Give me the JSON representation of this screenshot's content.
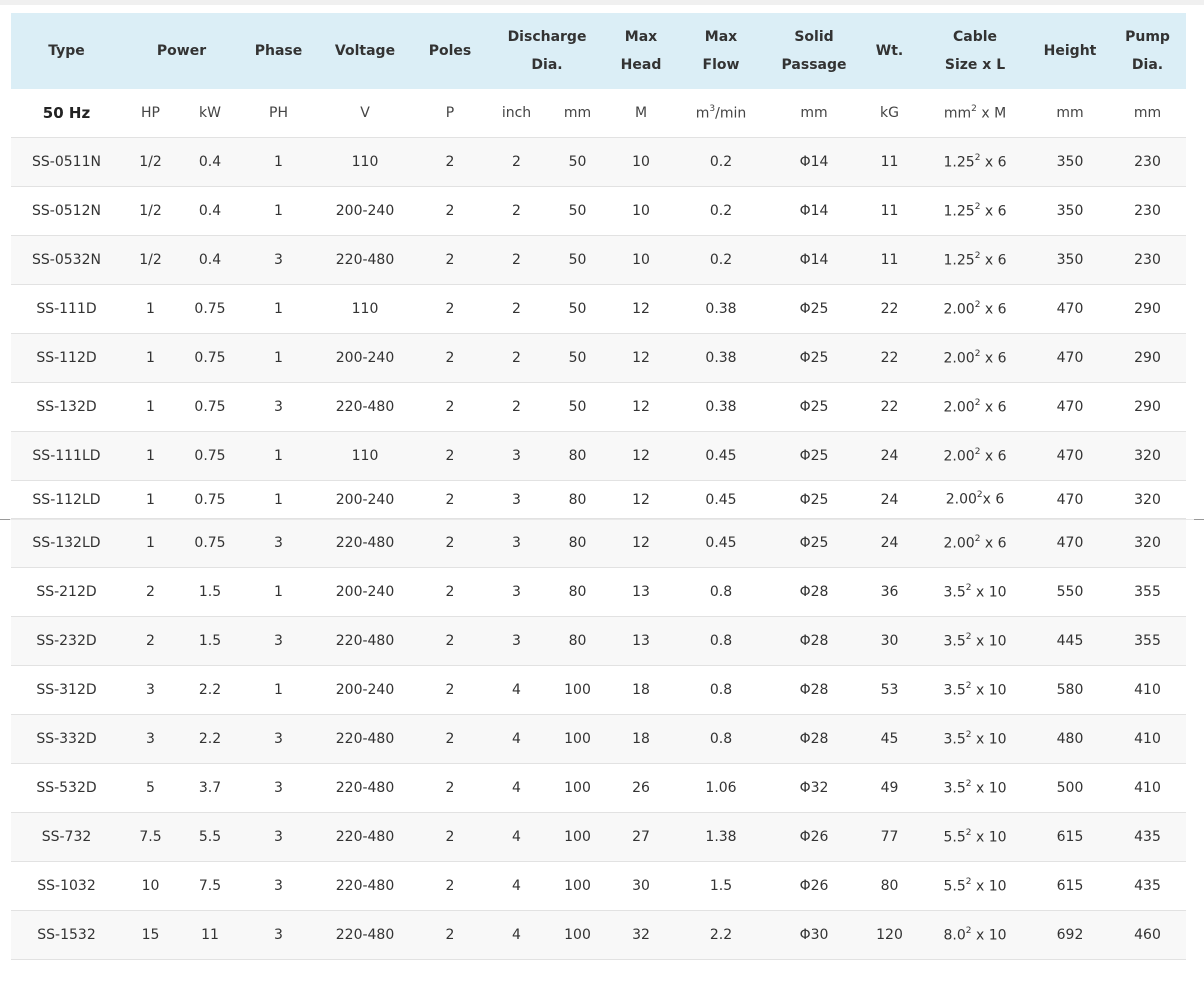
{
  "headers": {
    "type": "Type",
    "power": "Power",
    "phase": "Phase",
    "voltage": "Voltage",
    "poles": "Poles",
    "discharge_1": "Discharge",
    "discharge_2": "Dia.",
    "max_head_1": "Max",
    "max_head_2": "Head",
    "max_flow_1": "Max",
    "max_flow_2": "Flow",
    "solid_1": "Solid",
    "solid_2": "Passage",
    "wt": "Wt.",
    "cable_1": "Cable",
    "cable_2": "Size x L",
    "height": "Height",
    "pump_1": "Pump",
    "pump_2": "Dia."
  },
  "units": {
    "hz": "50 Hz",
    "hp": "HP",
    "kw": "kW",
    "ph": "PH",
    "v": "V",
    "p": "P",
    "inch": "inch",
    "mm_dis": "mm",
    "m": "M",
    "flow_pre": "m",
    "flow_sup": "3",
    "flow_post": "/min",
    "mm_solid": "mm",
    "kg": "kG",
    "cable_pre": "mm",
    "cable_sup": "2",
    "cable_post": " x M",
    "mm_h": "mm",
    "mm_p": "mm"
  },
  "rows": [
    {
      "type": "SS-0511N",
      "hp": "1/2",
      "kw": "0.4",
      "ph": "1",
      "v": "110",
      "p": "2",
      "inch": "2",
      "mm": "50",
      "head": "10",
      "flow": "0.2",
      "solid": "Φ14",
      "wt": "11",
      "cable_base": "1.25",
      "cable_exp": "2",
      "cable_len": " x 6",
      "height": "350",
      "pump": "230"
    },
    {
      "type": "SS-0512N",
      "hp": "1/2",
      "kw": "0.4",
      "ph": "1",
      "v": "200-240",
      "p": "2",
      "inch": "2",
      "mm": "50",
      "head": "10",
      "flow": "0.2",
      "solid": "Φ14",
      "wt": "11",
      "cable_base": "1.25",
      "cable_exp": "2",
      "cable_len": " x 6",
      "height": "350",
      "pump": "230"
    },
    {
      "type": "SS-0532N",
      "hp": "1/2",
      "kw": "0.4",
      "ph": "3",
      "v": "220-480",
      "p": "2",
      "inch": "2",
      "mm": "50",
      "head": "10",
      "flow": "0.2",
      "solid": "Φ14",
      "wt": "11",
      "cable_base": "1.25",
      "cable_exp": "2",
      "cable_len": " x 6",
      "height": "350",
      "pump": "230"
    },
    {
      "type": "SS-111D",
      "hp": "1",
      "kw": "0.75",
      "ph": "1",
      "v": "110",
      "p": "2",
      "inch": "2",
      "mm": "50",
      "head": "12",
      "flow": "0.38",
      "solid": "Φ25",
      "wt": "22",
      "cable_base": "2.00",
      "cable_exp": "2",
      "cable_len": " x 6",
      "height": "470",
      "pump": "290"
    },
    {
      "type": "SS-112D",
      "hp": "1",
      "kw": "0.75",
      "ph": "1",
      "v": "200-240",
      "p": "2",
      "inch": "2",
      "mm": "50",
      "head": "12",
      "flow": "0.38",
      "solid": "Φ25",
      "wt": "22",
      "cable_base": "2.00",
      "cable_exp": "2",
      "cable_len": " x 6",
      "height": "470",
      "pump": "290"
    },
    {
      "type": "SS-132D",
      "hp": "1",
      "kw": "0.75",
      "ph": "3",
      "v": "220-480",
      "p": "2",
      "inch": "2",
      "mm": "50",
      "head": "12",
      "flow": "0.38",
      "solid": "Φ25",
      "wt": "22",
      "cable_base": "2.00",
      "cable_exp": "2",
      "cable_len": " x 6",
      "height": "470",
      "pump": "290"
    },
    {
      "type": "SS-111LD",
      "hp": "1",
      "kw": "0.75",
      "ph": "1",
      "v": "110",
      "p": "2",
      "inch": "3",
      "mm": "80",
      "head": "12",
      "flow": "0.45",
      "solid": "Φ25",
      "wt": "24",
      "cable_base": "2.00",
      "cable_exp": "2",
      "cable_len": " x 6",
      "height": "470",
      "pump": "320"
    },
    {
      "type": "SS-112LD",
      "hp": "1",
      "kw": "0.75",
      "ph": "1",
      "v": "200-240",
      "p": "2",
      "inch": "3",
      "mm": "80",
      "head": "12",
      "flow": "0.45",
      "solid": "Φ25",
      "wt": "24",
      "cable_base": "2.00",
      "cable_exp": "2",
      "cable_len": "x 6",
      "height": "470",
      "pump": "320"
    },
    {
      "type": "SS-132LD",
      "hp": "1",
      "kw": "0.75",
      "ph": "3",
      "v": "220-480",
      "p": "2",
      "inch": "3",
      "mm": "80",
      "head": "12",
      "flow": "0.45",
      "solid": "Φ25",
      "wt": "24",
      "cable_base": "2.00",
      "cable_exp": "2",
      "cable_len": " x 6",
      "height": "470",
      "pump": "320"
    },
    {
      "type": "SS-212D",
      "hp": "2",
      "kw": "1.5",
      "ph": "1",
      "v": "200-240",
      "p": "2",
      "inch": "3",
      "mm": "80",
      "head": "13",
      "flow": "0.8",
      "solid": "Φ28",
      "wt": "36",
      "cable_base": "3.5",
      "cable_exp": "2",
      "cable_len": " x 10",
      "height": "550",
      "pump": "355"
    },
    {
      "type": "SS-232D",
      "hp": "2",
      "kw": "1.5",
      "ph": "3",
      "v": "220-480",
      "p": "2",
      "inch": "3",
      "mm": "80",
      "head": "13",
      "flow": "0.8",
      "solid": "Φ28",
      "wt": "30",
      "cable_base": "3.5",
      "cable_exp": "2",
      "cable_len": " x 10",
      "height": "445",
      "pump": "355"
    },
    {
      "type": "SS-312D",
      "hp": "3",
      "kw": "2.2",
      "ph": "1",
      "v": "200-240",
      "p": "2",
      "inch": "4",
      "mm": "100",
      "head": "18",
      "flow": "0.8",
      "solid": "Φ28",
      "wt": "53",
      "cable_base": "3.5",
      "cable_exp": "2",
      "cable_len": " x 10",
      "height": "580",
      "pump": "410"
    },
    {
      "type": "SS-332D",
      "hp": "3",
      "kw": "2.2",
      "ph": "3",
      "v": "220-480",
      "p": "2",
      "inch": "4",
      "mm": "100",
      "head": "18",
      "flow": "0.8",
      "solid": "Φ28",
      "wt": "45",
      "cable_base": "3.5",
      "cable_exp": "2",
      "cable_len": " x 10",
      "height": "480",
      "pump": "410"
    },
    {
      "type": "SS-532D",
      "hp": "5",
      "kw": "3.7",
      "ph": "3",
      "v": "220-480",
      "p": "2",
      "inch": "4",
      "mm": "100",
      "head": "26",
      "flow": "1.06",
      "solid": "Φ32",
      "wt": "49",
      "cable_base": "3.5",
      "cable_exp": "2",
      "cable_len": " x 10",
      "height": "500",
      "pump": "410"
    },
    {
      "type": "SS-732",
      "hp": "7.5",
      "kw": "5.5",
      "ph": "3",
      "v": "220-480",
      "p": "2",
      "inch": "4",
      "mm": "100",
      "head": "27",
      "flow": "1.38",
      "solid": "Φ26",
      "wt": "77",
      "cable_base": "5.5",
      "cable_exp": "2",
      "cable_len": " x 10",
      "height": "615",
      "pump": "435"
    },
    {
      "type": "SS-1032",
      "hp": "10",
      "kw": "7.5",
      "ph": "3",
      "v": "220-480",
      "p": "2",
      "inch": "4",
      "mm": "100",
      "head": "30",
      "flow": "1.5",
      "solid": "Φ26",
      "wt": "80",
      "cable_base": "5.5",
      "cable_exp": "2",
      "cable_len": " x 10",
      "height": "615",
      "pump": "435"
    },
    {
      "type": "SS-1532",
      "hp": "15",
      "kw": "11",
      "ph": "3",
      "v": "220-480",
      "p": "2",
      "inch": "4",
      "mm": "100",
      "head": "32",
      "flow": "2.2",
      "solid": "Φ30",
      "wt": "120",
      "cable_base": "8.0",
      "cable_exp": "2",
      "cable_len": " x 10",
      "height": "692",
      "pump": "460"
    }
  ]
}
